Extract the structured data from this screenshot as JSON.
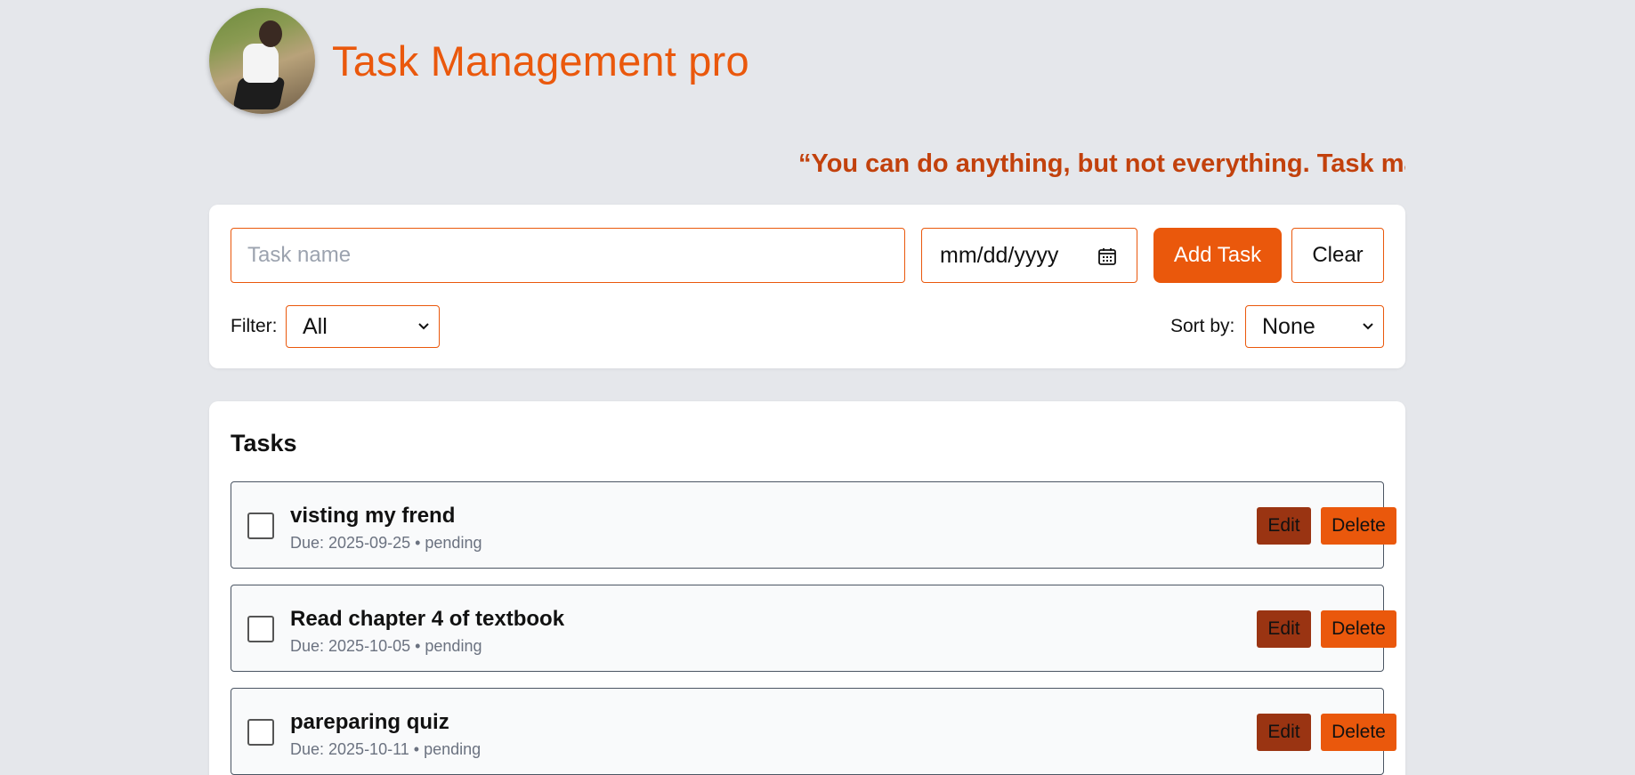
{
  "app": {
    "title": "Task Management pro",
    "quote": "“You can do anything, but not everything. Task ma"
  },
  "form": {
    "task_placeholder": "Task name",
    "date_placeholder": "mm/dd/yyyy",
    "add_label": "Add Task",
    "clear_label": "Clear",
    "filter_label": "Filter:",
    "filter_value": "All",
    "sort_label": "Sort by:",
    "sort_value": "None"
  },
  "tasks": {
    "heading": "Tasks",
    "edit_label": "Edit",
    "delete_label": "Delete",
    "items": [
      {
        "name": "visting my frend",
        "meta": "Due: 2025-09-25 • pending",
        "done": false
      },
      {
        "name": "Read chapter 4 of textbook",
        "meta": "Due: 2025-10-05 • pending",
        "done": false
      },
      {
        "name": "pareparing quiz",
        "meta": "Due: 2025-10-11 • pending",
        "done": false
      }
    ]
  },
  "colors": {
    "accent": "#ea580c",
    "quote": "#c2410c",
    "edit": "#9a3412",
    "background": "#e5e7eb"
  },
  "icons": [
    "avatar-photo",
    "calendar-icon",
    "chevron-down-icon"
  ]
}
